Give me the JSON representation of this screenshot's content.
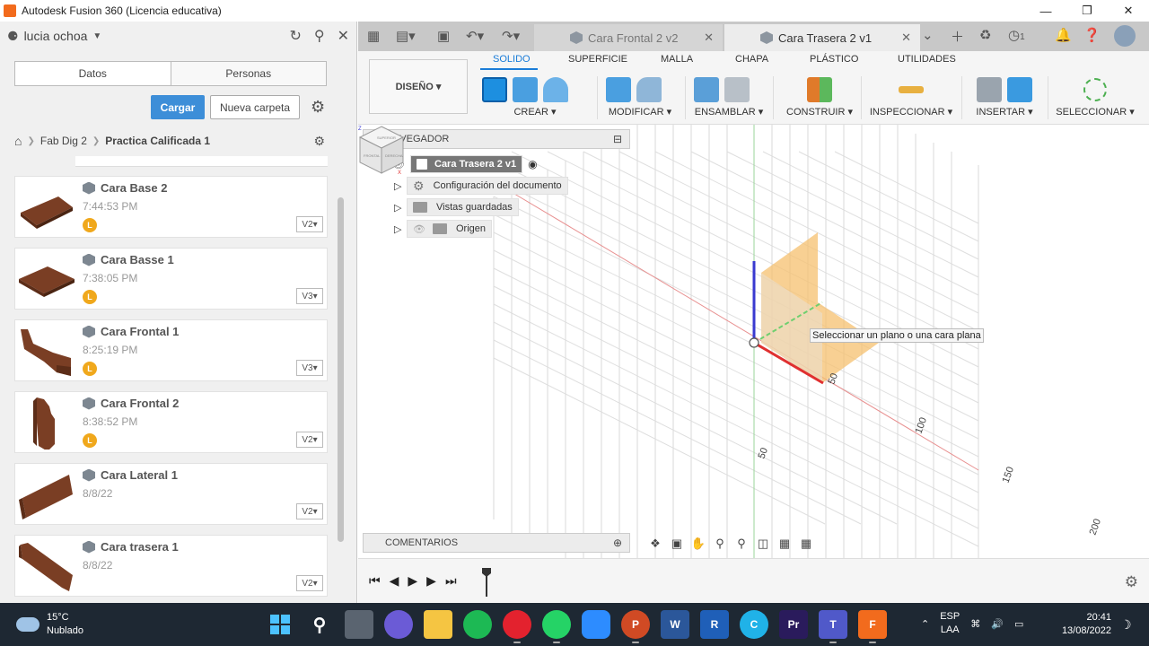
{
  "window": {
    "title": "Autodesk Fusion 360 (Licencia educativa)"
  },
  "data_panel": {
    "user": "lucia ochoa",
    "tabs": [
      {
        "label": "Datos"
      },
      {
        "label": "Personas"
      }
    ],
    "upload_label": "Cargar",
    "new_folder_label": "Nueva carpeta",
    "breadcrumb": [
      "Fab Dig 2",
      "Practica Calificada 1"
    ],
    "items": [
      {
        "name": "Cara Base 2",
        "time": "7:44:53 PM",
        "badge": "L",
        "version": "V2▾"
      },
      {
        "name": "Cara Basse 1",
        "time": "7:38:05 PM",
        "badge": "L",
        "version": "V3▾"
      },
      {
        "name": "Cara Frontal 1",
        "time": "8:25:19 PM",
        "badge": "L",
        "version": "V3▾"
      },
      {
        "name": "Cara Frontal 2",
        "time": "8:38:52 PM",
        "badge": "L",
        "version": "V2▾"
      },
      {
        "name": "Cara Lateral 1",
        "time": "8/8/22",
        "badge": "",
        "version": "V2▾"
      },
      {
        "name": "Cara trasera 1",
        "time": "8/8/22",
        "badge": "",
        "version": "V2▾"
      }
    ]
  },
  "doc_tabs": [
    {
      "label": "Cara Frontal 2 v2",
      "active": false
    },
    {
      "label": "Cara Trasera 2 v1",
      "active": true
    }
  ],
  "docbar": {
    "notif_count": "1"
  },
  "toolbar": {
    "workspace": "DISEÑO ▾",
    "tabs": [
      "SOLIDO",
      "SUPERFICIE",
      "MALLA",
      "CHAPA",
      "PLÁSTICO",
      "UTILIDADES"
    ],
    "groups": [
      "CREAR ▾",
      "MODIFICAR ▾",
      "ENSAMBLAR ▾",
      "CONSTRUIR ▾",
      "INSPECCIONAR ▾",
      "INSERTAR ▾",
      "SELECCIONAR ▾"
    ]
  },
  "browser": {
    "title": "NAVEGADOR",
    "root": "Cara Trasera 2 v1",
    "nodes": [
      "Configuración del documento",
      "Vistas guardadas",
      "Origen"
    ]
  },
  "viewport": {
    "tooltip": "Seleccionar un plano o una cara plana",
    "axis_labels": [
      "50",
      "100",
      "150",
      "200",
      "50"
    ],
    "viewcube_faces": [
      "SUPERIOR",
      "FRONTAL",
      "DERECHA"
    ]
  },
  "comments_label": "COMENTARIOS",
  "taskbar": {
    "temp": "15°C",
    "weather": "Nublado",
    "lang1": "ESP",
    "lang2": "LAA",
    "time": "20:41",
    "date": "13/08/2022"
  },
  "colors": {
    "accent": "#1a7cd8",
    "plane": "#f5c06f",
    "badge": "#f0a81c",
    "x_axis": "#e03030",
    "z_axis": "#3a3ad0"
  }
}
